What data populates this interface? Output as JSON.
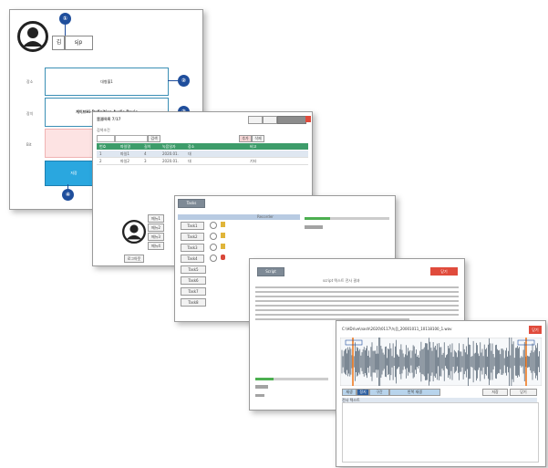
{
  "profile": {
    "name_value": "김",
    "id_value": "sjp",
    "field_labels": [
      "장소",
      "장치",
      "Bit"
    ],
    "place_value": "대형홀1",
    "device_value": "케이브Hi-Definition Audio Devic",
    "submit_label": "저장"
  },
  "list_window": {
    "title": "音源목록 7/17",
    "filter_label": "검색조건",
    "search_label": "검색",
    "buttons": [
      "추가",
      "삭제"
    ],
    "table_headers": [
      "번호",
      "파일명",
      "길이",
      "녹음일자",
      "장소",
      "비고"
    ],
    "rows": [
      [
        "1",
        "파일1",
        "4",
        "2020.01.",
        "대",
        ""
      ],
      [
        "2",
        "파일2",
        "3",
        "2020.01.",
        "대",
        "기타"
      ]
    ],
    "menu_items": [
      "메뉴1",
      "메뉴2",
      "메뉴3",
      "메뉴4"
    ],
    "footer_button": "로그아웃"
  },
  "task_window": {
    "tab_label": "Tasks",
    "header_label": "Recorder",
    "task_buttons": [
      "Task1",
      "Task2",
      "Task3",
      "Task4",
      "Task5",
      "Task6",
      "Task7",
      "Task8"
    ]
  },
  "text_window": {
    "tab_label": "Script",
    "title": "script 텍스트 전사 결과",
    "close_label": "닫기"
  },
  "wave_window": {
    "file_path": "C:\\HDrive\\nash\\2020\\0117\\녹음_20001011_10118100_1.wav",
    "close_label": "닫기",
    "buttons": [
      "재생",
      "정지",
      "구간",
      "반복 재생",
      "저장",
      "닫기"
    ],
    "transcript_label": "전사 텍스트"
  },
  "colors": {
    "accent_blue": "#1f4e9c",
    "box_border": "#3b8fb5",
    "submit_fill": "#2aa7df",
    "table_header": "#3d9c6a",
    "close_red": "#e04b3c",
    "wave": "#2c3e50",
    "marker_orange": "#f07b22"
  }
}
